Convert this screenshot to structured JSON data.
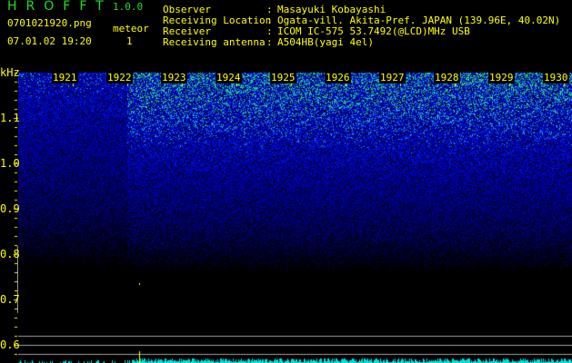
{
  "app": {
    "title": "HROFFT",
    "version": "1.0.0"
  },
  "file": {
    "name": "0701021920.png",
    "datetime": "07.01.02 19:20"
  },
  "meteor": {
    "label": "meteor",
    "count": "1"
  },
  "info": [
    {
      "label": "Observer",
      "value": "Masayuki Kobayashi"
    },
    {
      "label": "Receiving Location",
      "value": "Ogata-vill. Akita-Pref. JAPAN (139.96E, 40.02N)"
    },
    {
      "label": "Receiver",
      "value": "ICOM IC-575 53.7492(@LCD)MHz USB"
    },
    {
      "label": "Receiving antenna",
      "value": "A504HB(yagi 4el)"
    }
  ],
  "axis": {
    "unit": "kHz",
    "freq_labels": [
      "1.1",
      "1.0",
      "0.9",
      "0.8",
      "0.7",
      "0.6"
    ],
    "time_labels": [
      "1921",
      "1922",
      "1923",
      "1924",
      "1925",
      "1926",
      "1927",
      "1928",
      "1929",
      "1930"
    ]
  },
  "colors": {
    "text": "#ffff00",
    "title": "#22dd22",
    "hist": "#00e0e0",
    "grid": "#a0a0a0"
  }
}
